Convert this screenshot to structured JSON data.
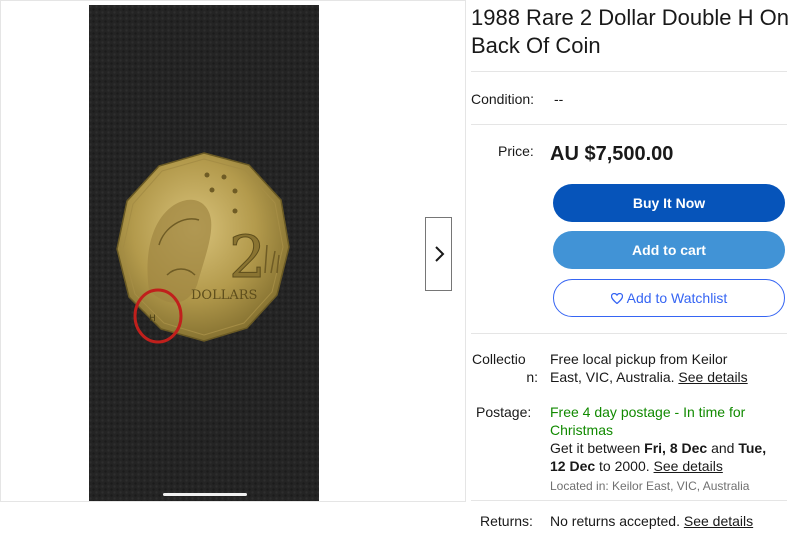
{
  "listing": {
    "title": "1988 Rare 2 Dollar Double H On Back Of Coin",
    "condition_label": "Condition:",
    "condition_value": "--",
    "price_label": "Price:",
    "price_value": "AU $7,500.00"
  },
  "buttons": {
    "buy_now": "Buy It Now",
    "add_to_cart": "Add to cart",
    "watchlist": "Add to Watchlist"
  },
  "coin": {
    "denomination": "2",
    "word": "DOLLARS"
  },
  "collection": {
    "label_line1": "Collectio",
    "label_line2": "n:",
    "text_line1": "Free local pickup from Keilor",
    "text_line2": "East, VIC, Australia.",
    "link": "See details"
  },
  "postage": {
    "label": "Postage:",
    "free_line1": "Free 4 day postage - In time for",
    "free_line2": "Christmas",
    "get_it": "Get it between",
    "date1": "Fri, 8 Dec",
    "and": "and",
    "date2a": "Tue,",
    "date2b": "12 Dec",
    "to": "to 2000.",
    "link": "See details",
    "located": "Located in: Keilor East, VIC, Australia"
  },
  "returns": {
    "label": "Returns:",
    "text": "No returns accepted.",
    "link": "See details"
  },
  "colors": {
    "buy_now": "#0654ba",
    "add_to_cart": "#4193d6",
    "watchlist_border": "#3665f3",
    "free_postage": "#118a00",
    "annotation_circle": "#c0201c"
  },
  "icons": [
    "chevron-right-icon",
    "heart-icon"
  ]
}
